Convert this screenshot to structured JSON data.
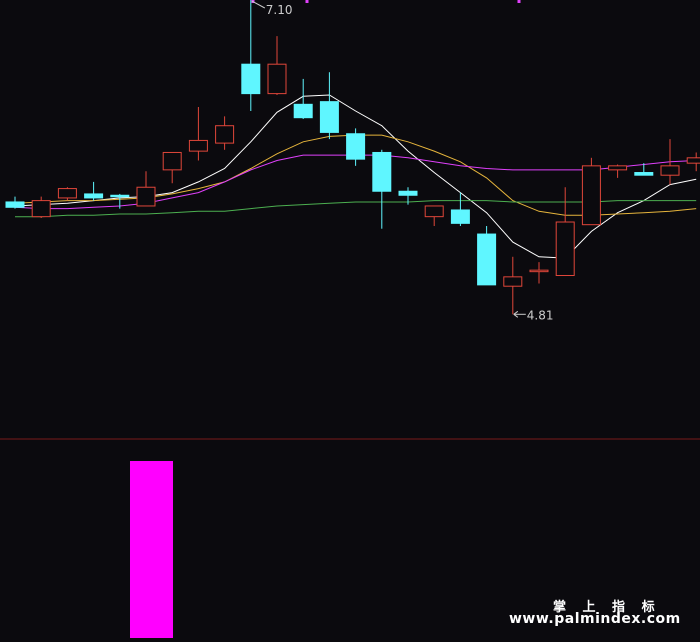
{
  "chart_data": {
    "type": "candlestick",
    "title": "",
    "price_range": [
      3.9,
      7.16
    ],
    "candles": [
      {
        "o": 5.65,
        "h": 5.69,
        "l": 5.6,
        "c": 5.61
      },
      {
        "o": 5.54,
        "h": 5.69,
        "l": 5.53,
        "c": 5.66
      },
      {
        "o": 5.68,
        "h": 5.76,
        "l": 5.66,
        "c": 5.75
      },
      {
        "o": 5.71,
        "h": 5.8,
        "l": 5.66,
        "c": 5.68
      },
      {
        "o": 5.7,
        "h": 5.71,
        "l": 5.6,
        "c": 5.69
      },
      {
        "o": 5.62,
        "h": 5.88,
        "l": 5.62,
        "c": 5.76
      },
      {
        "o": 5.89,
        "h": 6.02,
        "l": 5.79,
        "c": 6.02
      },
      {
        "o": 6.03,
        "h": 6.36,
        "l": 5.96,
        "c": 6.11
      },
      {
        "o": 6.09,
        "h": 6.29,
        "l": 6.04,
        "c": 6.22
      },
      {
        "o": 6.68,
        "h": 7.16,
        "l": 6.33,
        "c": 6.46
      },
      {
        "o": 6.46,
        "h": 6.89,
        "l": 6.45,
        "c": 6.68
      },
      {
        "o": 6.38,
        "h": 6.57,
        "l": 6.27,
        "c": 6.28
      },
      {
        "o": 6.4,
        "h": 6.62,
        "l": 6.12,
        "c": 6.17
      },
      {
        "o": 6.16,
        "h": 6.2,
        "l": 5.92,
        "c": 5.97
      },
      {
        "o": 6.02,
        "h": 6.04,
        "l": 5.45,
        "c": 5.73
      },
      {
        "o": 5.73,
        "h": 5.76,
        "l": 5.63,
        "c": 5.7
      },
      {
        "o": 5.54,
        "h": 5.62,
        "l": 5.47,
        "c": 5.62
      },
      {
        "o": 5.59,
        "h": 5.72,
        "l": 5.47,
        "c": 5.49
      },
      {
        "o": 5.41,
        "h": 5.47,
        "l": 5.03,
        "c": 5.03
      },
      {
        "o": 5.02,
        "h": 5.24,
        "l": 4.81,
        "c": 5.09
      },
      {
        "o": 5.13,
        "h": 5.2,
        "l": 5.04,
        "c": 5.14
      },
      {
        "o": 5.1,
        "h": 5.76,
        "l": 5.1,
        "c": 5.5
      },
      {
        "o": 5.48,
        "h": 5.98,
        "l": 5.48,
        "c": 5.92
      },
      {
        "o": 5.89,
        "h": 5.93,
        "l": 5.83,
        "c": 5.92
      },
      {
        "o": 5.87,
        "h": 5.94,
        "l": 5.86,
        "c": 5.85
      },
      {
        "o": 5.85,
        "h": 6.12,
        "l": 5.78,
        "c": 5.92
      },
      {
        "o": 5.94,
        "h": 6.02,
        "l": 5.88,
        "c": 5.98
      }
    ],
    "moving_averages": [
      {
        "color": "#ffffff",
        "values": [
          5.62,
          5.63,
          5.64,
          5.66,
          5.68,
          5.69,
          5.72,
          5.8,
          5.9,
          6.1,
          6.32,
          6.44,
          6.45,
          6.33,
          6.22,
          6.03,
          5.87,
          5.72,
          5.57,
          5.35,
          5.24,
          5.23,
          5.43,
          5.57,
          5.66,
          5.78,
          5.82
        ]
      },
      {
        "color": "#e5b43c",
        "values": [
          5.64,
          5.65,
          5.66,
          5.66,
          5.67,
          5.68,
          5.71,
          5.75,
          5.8,
          5.9,
          6.01,
          6.1,
          6.14,
          6.15,
          6.15,
          6.1,
          6.03,
          5.95,
          5.83,
          5.66,
          5.58,
          5.55,
          5.55,
          5.56,
          5.57,
          5.58,
          5.6
        ]
      },
      {
        "color": "#e040fb",
        "values": [
          5.61,
          5.6,
          5.6,
          5.61,
          5.62,
          5.64,
          5.68,
          5.72,
          5.8,
          5.89,
          5.96,
          6.0,
          6.0,
          6.0,
          6.0,
          5.98,
          5.95,
          5.92,
          5.9,
          5.89,
          5.89,
          5.89,
          5.89,
          5.91,
          5.93,
          5.95,
          5.96
        ]
      },
      {
        "color": "#4caf50",
        "values": [
          5.54,
          5.54,
          5.55,
          5.55,
          5.56,
          5.56,
          5.57,
          5.58,
          5.58,
          5.6,
          5.62,
          5.63,
          5.64,
          5.65,
          5.65,
          5.65,
          5.66,
          5.66,
          5.66,
          5.65,
          5.65,
          5.65,
          5.65,
          5.66,
          5.66,
          5.66,
          5.66
        ]
      }
    ],
    "annotations": [
      {
        "label": "7.10",
        "candle": 9,
        "price": 7.16
      },
      {
        "label": "4.81",
        "candle": 19,
        "price": 4.81
      }
    ],
    "indicator_bars": [
      {
        "candle": 4,
        "value": 1.0,
        "color": "#ff00ff"
      }
    ],
    "colors": {
      "up": "#e0463a",
      "down": "#5ff6ff",
      "background": "#0b0a0e",
      "divider": "#7a1a1a"
    }
  },
  "watermark": {
    "line1": "掌 上 指 标",
    "line2": "www.palmindex.com"
  }
}
